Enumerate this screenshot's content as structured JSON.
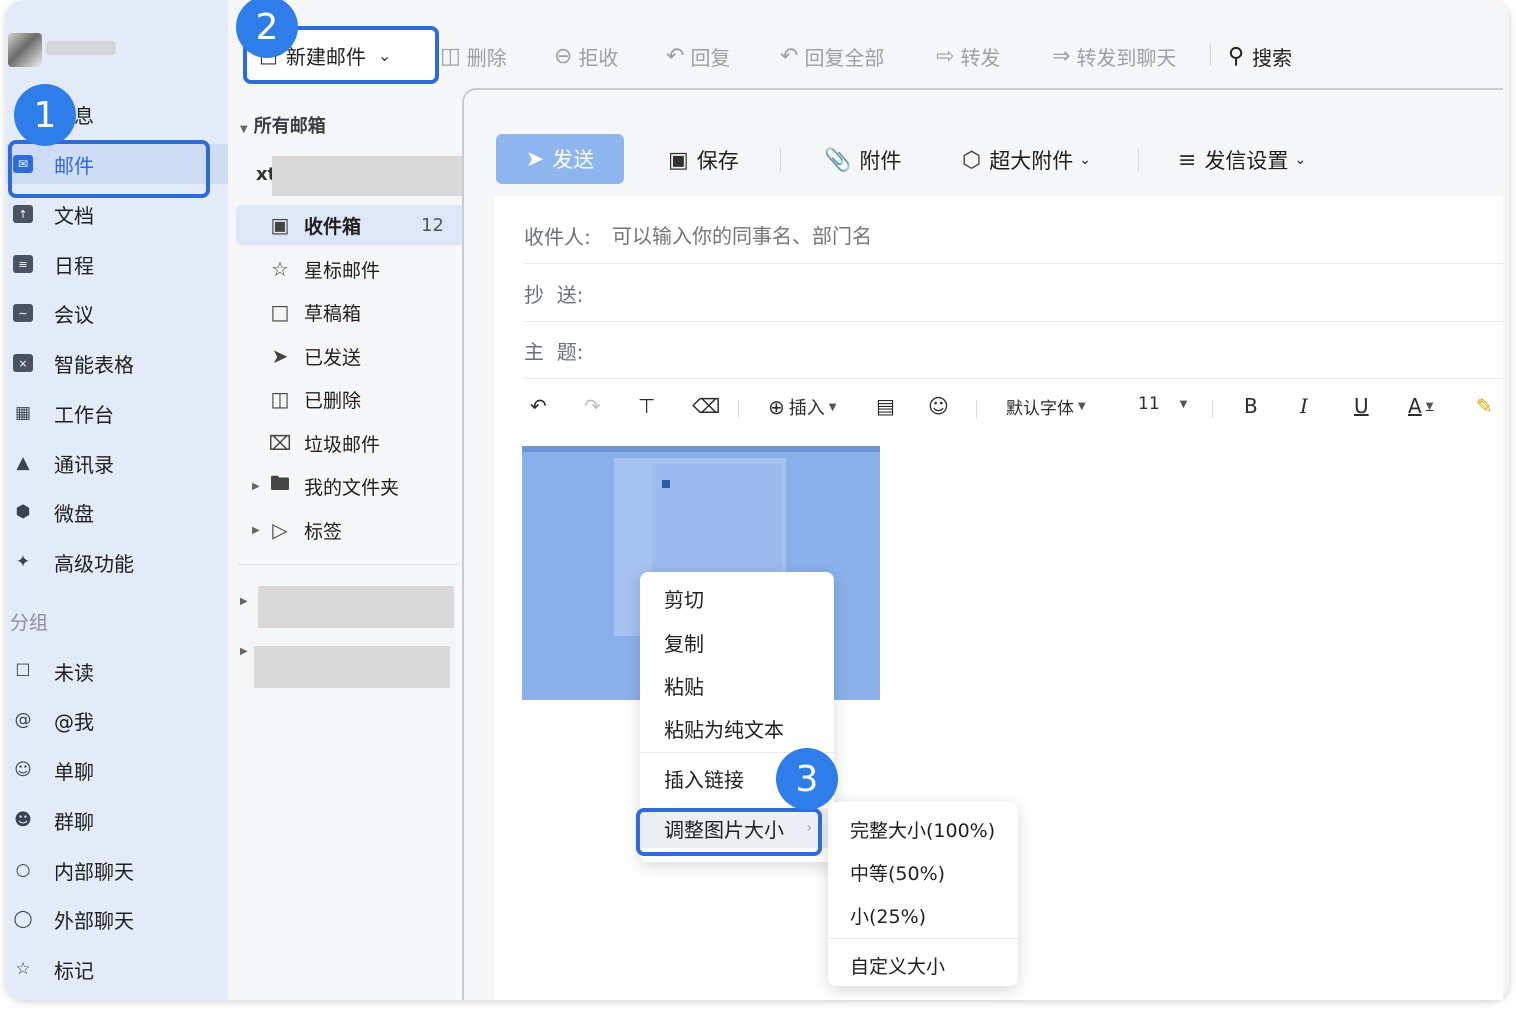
{
  "profile": {
    "username": "**"
  },
  "leftnav": {
    "items": [
      {
        "label": "消息",
        "icon": "message-icon"
      },
      {
        "label": "邮件",
        "icon": "mail-icon"
      },
      {
        "label": "文档",
        "icon": "document-icon"
      },
      {
        "label": "日程",
        "icon": "calendar-icon"
      },
      {
        "label": "会议",
        "icon": "meeting-icon"
      },
      {
        "label": "智能表格",
        "icon": "smart-sheet-icon"
      },
      {
        "label": "工作台",
        "icon": "workbench-icon"
      },
      {
        "label": "通讯录",
        "icon": "contacts-icon"
      },
      {
        "label": "微盘",
        "icon": "drive-icon"
      },
      {
        "label": "高级功能",
        "icon": "advanced-icon"
      }
    ],
    "group_title": "分组",
    "groups": [
      {
        "label": "未读",
        "icon": "unread-icon"
      },
      {
        "label": "@我",
        "icon": "at-icon"
      },
      {
        "label": "单聊",
        "icon": "single-chat-icon"
      },
      {
        "label": "群聊",
        "icon": "group-chat-icon"
      },
      {
        "label": "内部聊天",
        "icon": "internal-chat-icon"
      },
      {
        "label": "外部聊天",
        "icon": "external-chat-icon"
      },
      {
        "label": "标记",
        "icon": "star-icon"
      }
    ]
  },
  "folders": {
    "header": "所有邮箱",
    "account_prefix": "xt",
    "items": [
      {
        "label": "收件箱",
        "count": "12",
        "icon": "inbox-icon"
      },
      {
        "label": "星标邮件",
        "icon": "star-icon"
      },
      {
        "label": "草稿箱",
        "icon": "draft-icon"
      },
      {
        "label": "已发送",
        "icon": "sent-icon"
      },
      {
        "label": "已删除",
        "icon": "trash-icon"
      },
      {
        "label": "垃圾邮件",
        "icon": "spam-icon"
      },
      {
        "label": "我的文件夹",
        "icon": "folder-icon"
      },
      {
        "label": "标签",
        "icon": "tag-icon"
      }
    ]
  },
  "toolbar": {
    "new_mail": "新建邮件",
    "delete": "删除",
    "reject": "拒收",
    "reply": "回复",
    "reply_all": "回复全部",
    "forward": "转发",
    "forward_chat": "转发到聊天",
    "search": "搜索"
  },
  "compose": {
    "send": "发送",
    "save": "保存",
    "attach": "附件",
    "large_attach": "超大附件",
    "send_settings": "发信设置",
    "to_label": "收件人:",
    "to_placeholder": "可以输入你的同事名、部门名",
    "cc_label": "抄  送:",
    "subject_label": "主  题:",
    "format": {
      "insert": "插入",
      "font": "默认字体",
      "size": "11",
      "bold": "B",
      "italic": "I",
      "underline": "U",
      "font_color": "A"
    }
  },
  "context_menu": {
    "items": [
      "剪切",
      "复制",
      "粘贴",
      "粘贴为纯文本",
      "插入链接",
      "调整图片大小"
    ]
  },
  "submenu": {
    "items": [
      "完整大小(100%)",
      "中等(50%)",
      "小(25%)",
      "自定义大小"
    ]
  },
  "steps": [
    "1",
    "2",
    "3"
  ],
  "colors": {
    "accent": "#2f6bd8",
    "badge": "#2f7de8",
    "nav_bg": "#e4ebf8"
  }
}
